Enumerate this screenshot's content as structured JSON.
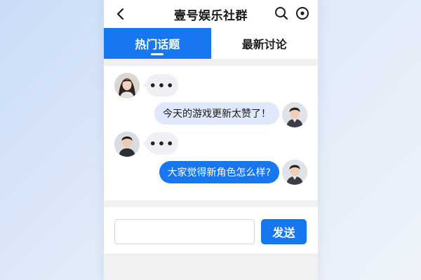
{
  "header": {
    "title": "壹号娱乐社群",
    "back_icon": "chevron-left-icon",
    "search_icon": "search-icon",
    "more_icon": "more-circle-icon"
  },
  "tabs": [
    {
      "label": "热门话题",
      "active": true
    },
    {
      "label": "最新讨论",
      "active": false
    }
  ],
  "messages": [
    {
      "side": "left",
      "type": "typing",
      "text": "•••",
      "avatar": "female-avatar"
    },
    {
      "side": "right",
      "type": "text",
      "text": "今天的游戏更新太赞了！",
      "avatar": "male-avatar"
    },
    {
      "side": "left",
      "type": "typing",
      "text": "•••",
      "avatar": "male-avatar-2"
    },
    {
      "side": "right",
      "type": "text",
      "text": "大家觉得新角色怎么样?",
      "avatar": "male-avatar"
    }
  ],
  "composer": {
    "input_value": "",
    "input_placeholder": "",
    "send_label": "发送"
  },
  "colors": {
    "accent": "#1677f0",
    "light_bubble": "#dfe9fb",
    "typing_bubble": "#eef0f4"
  }
}
